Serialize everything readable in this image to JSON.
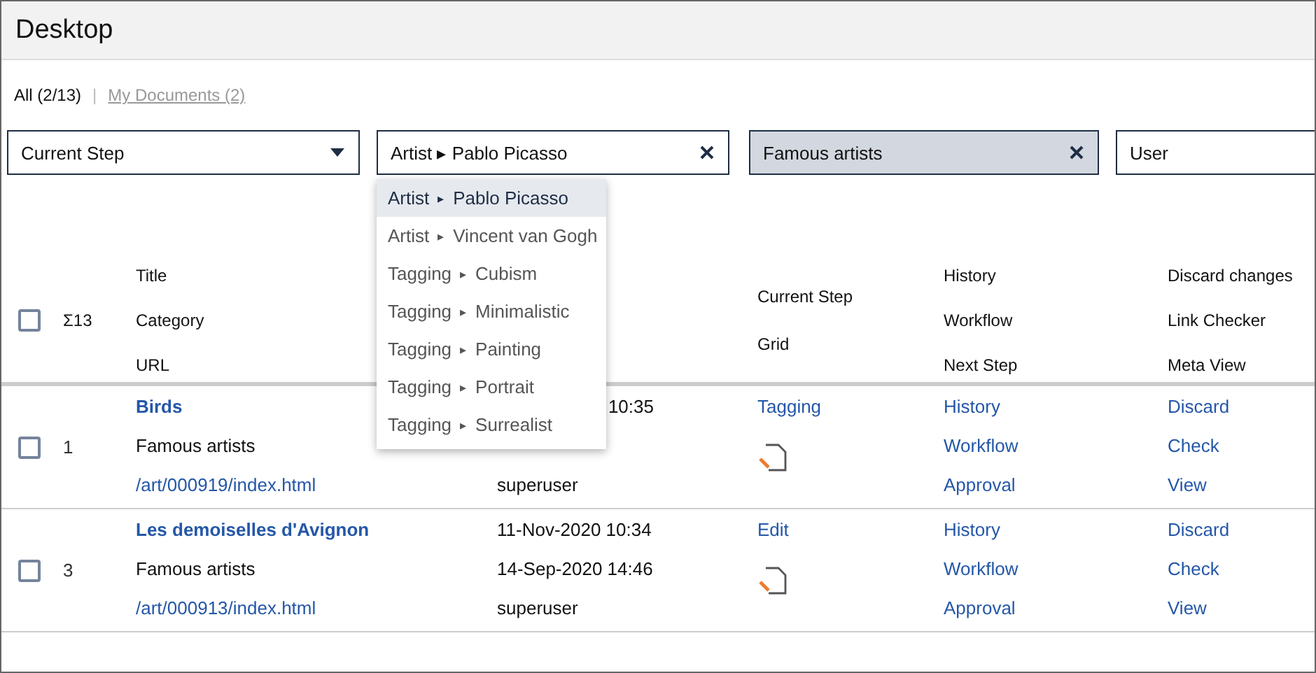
{
  "window": {
    "title": "Desktop"
  },
  "views": [
    {
      "label": "All (2/13)",
      "selected": true
    },
    {
      "label": "My Documents (2)",
      "selected": false
    }
  ],
  "views_separator": "|",
  "filters": [
    {
      "kind": "select",
      "value": "Current Step"
    },
    {
      "kind": "input",
      "value": "Artist ▸ Pablo Picasso"
    },
    {
      "kind": "chip",
      "value": "Famous artists"
    },
    {
      "kind": "input-plain",
      "value": "User"
    }
  ],
  "dropdown": {
    "arrow": "▸",
    "items": [
      {
        "group": "Artist",
        "value": "Pablo Picasso",
        "selected": true
      },
      {
        "group": "Artist",
        "value": "Vincent van Gogh",
        "selected": false
      },
      {
        "group": "Tagging",
        "value": "Cubism",
        "selected": false
      },
      {
        "group": "Tagging",
        "value": "Minimalistic",
        "selected": false
      },
      {
        "group": "Tagging",
        "value": "Painting",
        "selected": false
      },
      {
        "group": "Tagging",
        "value": "Portrait",
        "selected": false
      },
      {
        "group": "Tagging",
        "value": "Surrealist",
        "selected": false
      }
    ]
  },
  "table": {
    "count": "Σ13",
    "checked": false,
    "header": [
      [
        "Title",
        "Category",
        "URL"
      ],
      [
        "Current Step",
        "Grid"
      ],
      [
        "History",
        "Workflow",
        "Next Step"
      ],
      [
        "Discard changes",
        "Link Checker",
        "Meta View"
      ]
    ],
    "rows": [
      {
        "number": "1",
        "checked": false,
        "title": "Birds",
        "category": "Famous artists",
        "url": "/art/000919/index.html",
        "column_2": {
          "line_1": {
            "text": "10:35",
            "clipped": true
          },
          "line_3": {
            "text": "superuser",
            "clipped": false
          }
        },
        "step": "Tagging",
        "actions": [
          "History",
          "Workflow",
          "Approval"
        ],
        "tools": [
          "Discard",
          "Check",
          "View"
        ]
      },
      {
        "number": "3",
        "checked": false,
        "title": "Les demoiselles d'Avignon",
        "category": "Famous artists",
        "url": "/art/000913/index.html",
        "column_2": {
          "line_1": {
            "text": "11-Nov-2020 10:34",
            "clipped": false
          },
          "line_2": {
            "text": "14-Sep-2020 14:46",
            "clipped": false
          },
          "line_3": {
            "text": "superuser",
            "clipped": false
          }
        },
        "step": "Edit",
        "actions": [
          "History",
          "Workflow",
          "Approval"
        ],
        "tools": [
          "Discard",
          "Check",
          "View"
        ]
      }
    ]
  }
}
